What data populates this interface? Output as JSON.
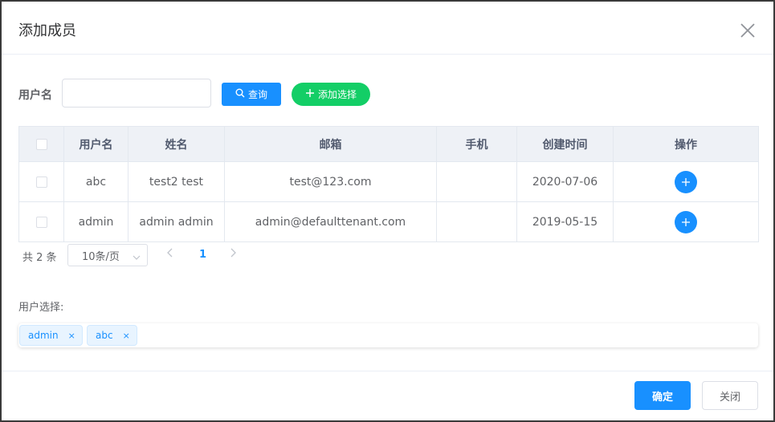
{
  "dialog": {
    "title": "添加成员",
    "close_icon": "close-icon"
  },
  "search": {
    "label": "用户名",
    "value": "",
    "placeholder": "",
    "query_label": "查询",
    "add_select_label": "添加选择"
  },
  "table": {
    "columns": [
      "用户名",
      "姓名",
      "邮箱",
      "手机",
      "创建时间",
      "操作"
    ],
    "rows": [
      {
        "username": "abc",
        "name": "test2 test",
        "email": "test@123.com",
        "phone": "",
        "created": "2020-07-06"
      },
      {
        "username": "admin",
        "name": "admin admin",
        "email": "admin@defaulttenant.com",
        "phone": "",
        "created": "2019-05-15"
      }
    ]
  },
  "pagination": {
    "total": "共 2 条",
    "page_size": "10条/页",
    "current_page": "1"
  },
  "selection": {
    "label": "用户选择:",
    "tags": [
      "admin",
      "abc"
    ],
    "tag_close": "×"
  },
  "footer": {
    "confirm_label": "确定",
    "close_label": "关闭"
  },
  "colors": {
    "primary": "#1890ff",
    "success": "#13ce66",
    "header_bg": "#eef1f6",
    "border": "#e3e8ef"
  }
}
